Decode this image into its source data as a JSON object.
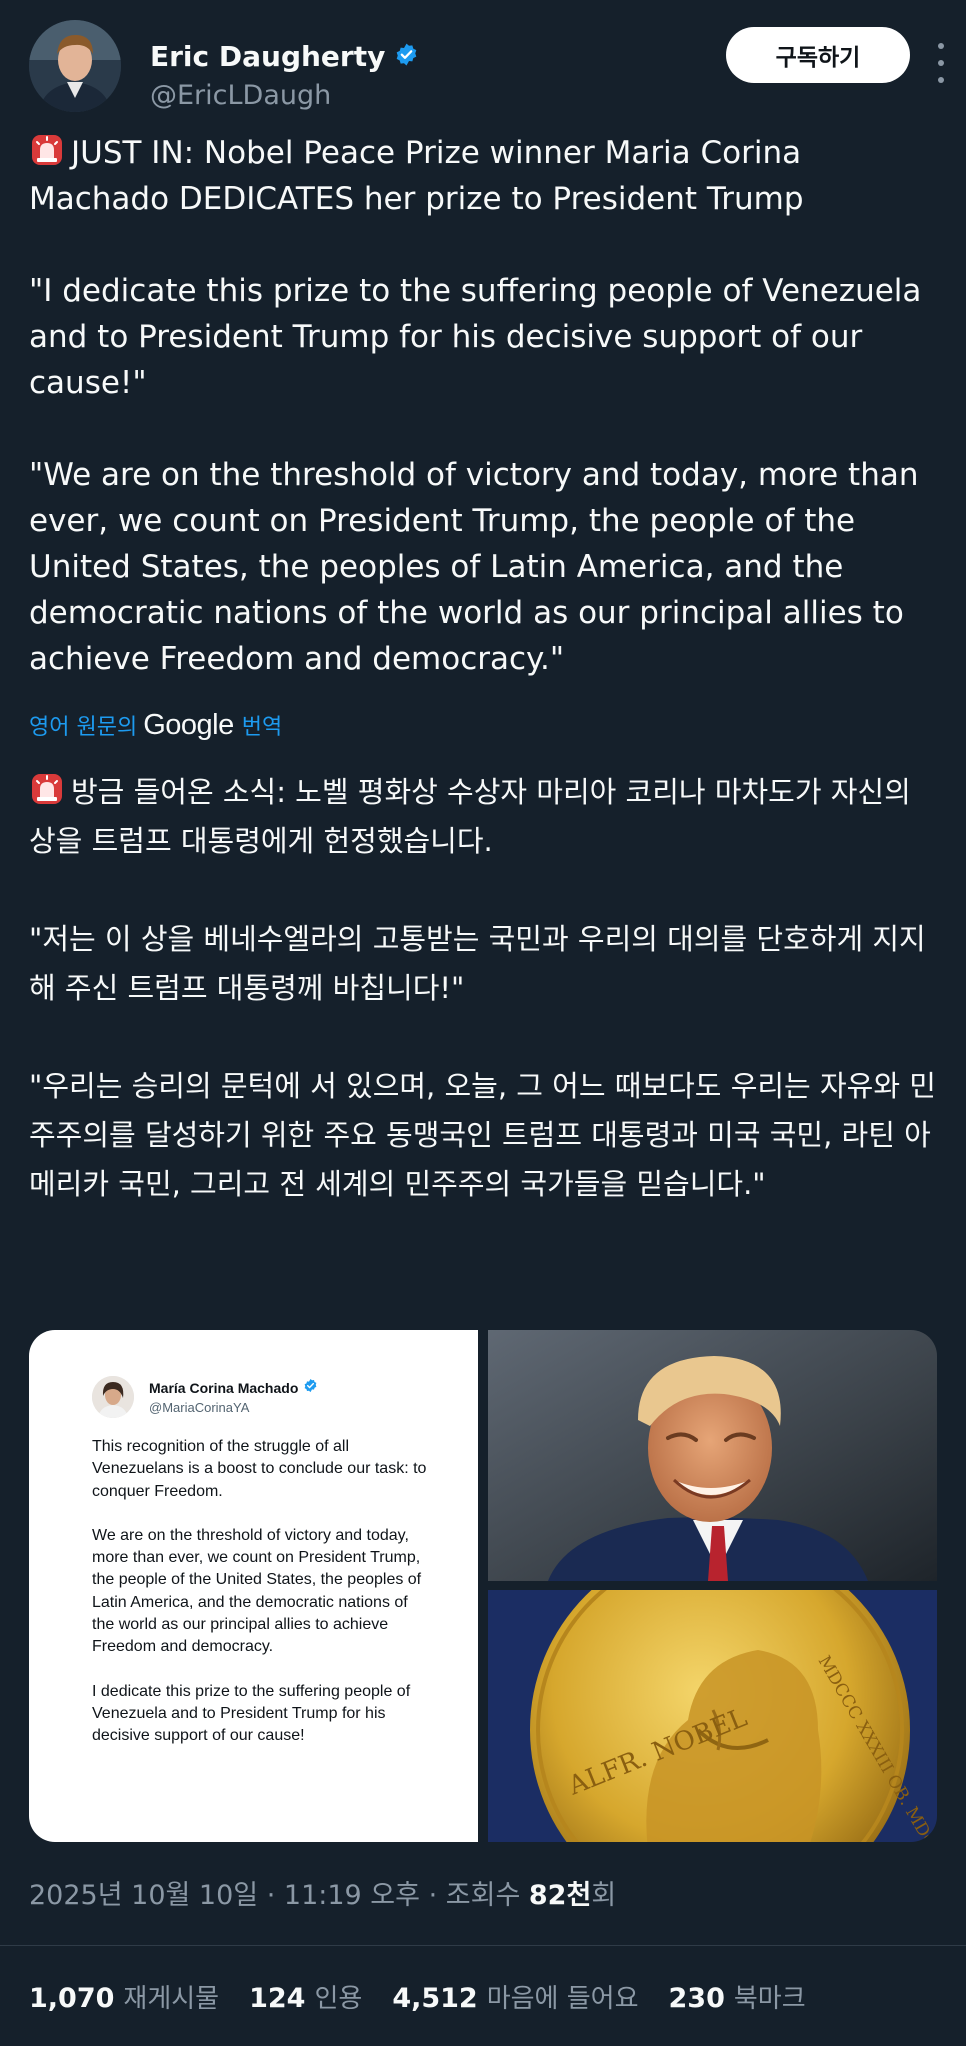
{
  "author": {
    "name": "Eric Daugherty",
    "handle": "@EricLDaugh",
    "verified": true,
    "subscribe_label": "구독하기"
  },
  "tweet": {
    "english_lines": [
      "JUST IN: Nobel Peace Prize winner Maria Corina Machado DEDICATES her prize to President Trump",
      "\"I dedicate this prize to the suffering people of Venezuela and to President Trump for his decisive support of our cause!\"",
      "\"We are on the threshold of victory and today, more than ever, we count on President Trump, the people of the United States, the peoples of Latin America, and the democratic nations of the world as our principal allies to achieve Freedom and democracy.\""
    ],
    "translate_prefix": "영어 원문의",
    "translate_brand": "Google",
    "translate_suffix": "번역",
    "korean_lines": [
      "방금 들어온 소식: 노벨 평화상 수상자 마리아 코리나 마차도가 자신의 상을 트럼프 대통령에게 헌정했습니다.",
      "\"저는 이 상을 베네수엘라의 고통받는 국민과 우리의 대의를 단호하게 지지해 주신 트럼프 대통령께 바칩니다!\"",
      "\"우리는 승리의 문턱에 서 있으며, 오늘, 그 어느 때보다도 우리는 자유와 민주주의를 달성하기 위한 주요 동맹국인 트럼프 대통령과 미국 국민, 라틴 아메리카 국민, 그리고 전 세계의 민주주의 국가들을 믿습니다.\""
    ]
  },
  "embedded_card": {
    "name": "María Corina Machado",
    "handle": "@MariaCorinaYA",
    "paragraphs": [
      "This recognition of the struggle of all Venezuelans is a boost to conclude our task: to conquer Freedom.",
      "We are on the threshold of victory and today, more than ever, we count on President Trump, the people of the United States, the peoples of Latin America, and the democratic nations of the world as our principal allies to achieve Freedom and democracy.",
      "I dedicate this prize to the suffering people of Venezuela and to President Trump for his decisive support of our cause!"
    ]
  },
  "medal": {
    "inscription_left": "ALFR. NOBEL",
    "inscription_right": "MDCCC XXXIII OB. MDCCC XCVI"
  },
  "meta": {
    "date": "2025년 10월 10일",
    "separator": "·",
    "time": "11:19 오후",
    "views_label": "조회수",
    "views_value": "82천",
    "views_suffix": "회"
  },
  "stats": [
    {
      "value": "1,070",
      "label": "재게시물"
    },
    {
      "value": "124",
      "label": "인용"
    },
    {
      "value": "4,512",
      "label": "마음에 들어요"
    },
    {
      "value": "230",
      "label": "북마크"
    }
  ],
  "colors": {
    "background": "#15202b",
    "accent": "#1d9bf0",
    "muted": "#8b98a5"
  },
  "icons": [
    "verified-badge-icon",
    "more-options-icon",
    "siren-emoji-icon"
  ]
}
